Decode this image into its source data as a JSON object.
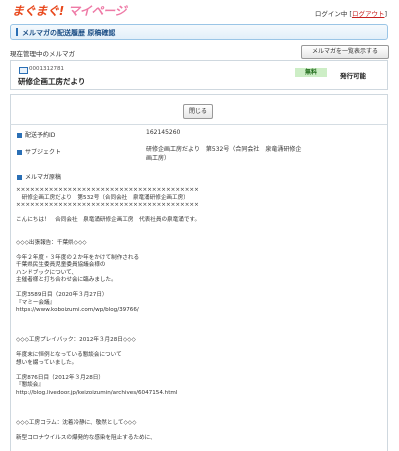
{
  "header": {
    "logo_main": "まぐまぐ!",
    "logo_sub": "マイページ",
    "login_status": "ログイン中",
    "logout_label": "ログアウト"
  },
  "page": {
    "title": "メルマガの配送履歴 原稿確認"
  },
  "current": {
    "label": "現在管理中のメルマガ",
    "list_button": "メルマガを一覧表示する"
  },
  "magazine": {
    "id": "0001312781",
    "name": "研修企画工房だより",
    "price_badge": "無料",
    "status": "発行可能"
  },
  "actions": {
    "close_label": "閉じる"
  },
  "details": {
    "delivery_id_label": "配送予約ID",
    "delivery_id_value": "162145260",
    "subject_label": "サブジェクト",
    "subject_value": "研修企画工房だより　第532号（合同会社　泉竜涌研修企画工房）",
    "body_label": "メルマガ原稿"
  },
  "body_lines": [
    "×××××××××××××××××××××××××××××××××××××××",
    "　研修企画工房だより　第532号（合同会社　泉竜涌研修企画工房）",
    "×××××××××××××××××××××××××××××××××××××××",
    "",
    "こんにちは！　合同会社　泉竜涌研修企画工房　代表社員の泉竜涌です。",
    "",
    "",
    "◇◇◇出張報告：千葉県◇◇◇",
    "",
    "今年２年度・３年度の２か年をかけて制作される",
    "千葉県民生委員児童委員協議会様の",
    "ハンドブックについて、",
    "主催者様と打ち合わせ会に臨みました。",
    "",
    "工房3589日目（2020年３月27日）",
    "『マミー会議』",
    "https://www.koboizumi.com/wp/blog/39766/",
    "",
    "",
    "",
    "◇◇◇工房プレイバック：2012年３月28日◇◇◇",
    "",
    "年度末に恒例となっている懇談会について",
    "想いを綴っていました。",
    "",
    "工房876日目（2012年３月28日）",
    "『懇談会』",
    "http://blog.livedoor.jp/keizoizumin/archives/6047154.html",
    "",
    "",
    "",
    "◇◇◇工房コラム：沈着冷静に、敬然として◇◇◇",
    "",
    "新型コロナウイルスの爆発的な感染を阻止するために、"
  ]
}
